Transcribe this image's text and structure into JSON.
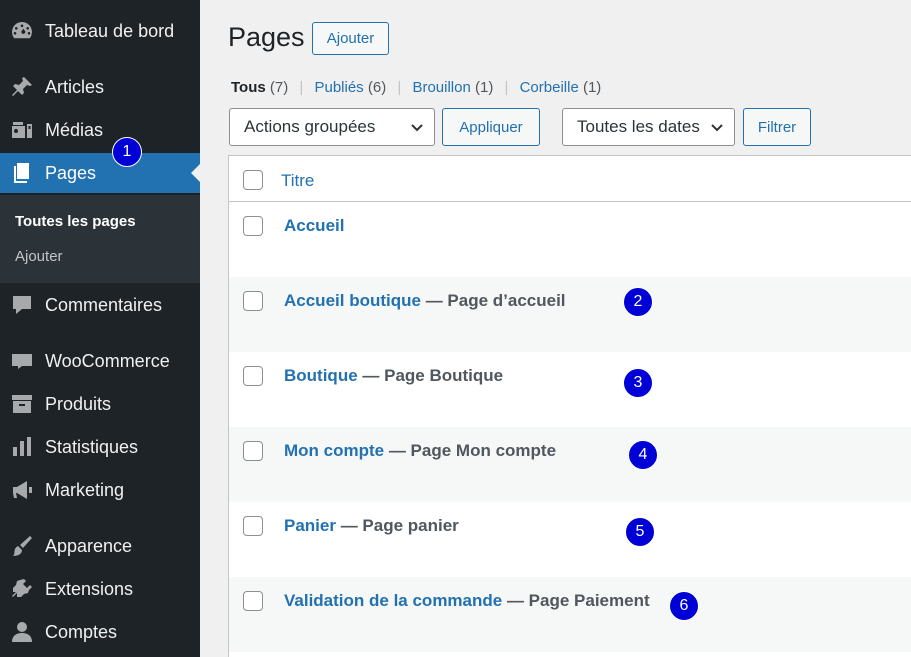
{
  "sidebar": {
    "items": [
      {
        "label": "Tableau de bord",
        "icon": "dashboard-icon"
      },
      {
        "label": "Articles",
        "icon": "pin-icon"
      },
      {
        "label": "Médias",
        "icon": "media-icon"
      },
      {
        "label": "Pages",
        "icon": "pages-icon",
        "active": true
      },
      {
        "label": "Commentaires",
        "icon": "comment-icon"
      },
      {
        "label": "WooCommerce",
        "icon": "woocommerce-icon"
      },
      {
        "label": "Produits",
        "icon": "archive-icon"
      },
      {
        "label": "Statistiques",
        "icon": "bar-chart-icon"
      },
      {
        "label": "Marketing",
        "icon": "megaphone-icon"
      },
      {
        "label": "Apparence",
        "icon": "brush-icon"
      },
      {
        "label": "Extensions",
        "icon": "plugin-icon"
      },
      {
        "label": "Comptes",
        "icon": "user-icon"
      }
    ],
    "submenu": {
      "all_pages": "Toutes les pages",
      "add": "Ajouter"
    }
  },
  "header": {
    "title": "Pages",
    "add_button": "Ajouter"
  },
  "filters": {
    "all": {
      "label": "Tous",
      "count": "(7)"
    },
    "published": {
      "label": "Publiés",
      "count": "(6)"
    },
    "draft": {
      "label": "Brouillon",
      "count": "(1)"
    },
    "trash": {
      "label": "Corbeille",
      "count": "(1)"
    },
    "separator": "|"
  },
  "toolbar": {
    "bulk_actions": "Actions groupées",
    "apply": "Appliquer",
    "dates": "Toutes les dates",
    "filter": "Filtrer"
  },
  "table": {
    "column_title": "Titre",
    "rows": [
      {
        "title": "Accueil",
        "state": ""
      },
      {
        "title": "Accueil boutique",
        "state": " — Page d’accueil"
      },
      {
        "title": "Boutique",
        "state": " — Page Boutique"
      },
      {
        "title": "Mon compte",
        "state": " — Page Mon compte"
      },
      {
        "title": "Panier",
        "state": " — Page panier"
      },
      {
        "title": "Validation de la commande",
        "state": " — Page Paiement"
      }
    ]
  },
  "annotations": [
    "1",
    "2",
    "3",
    "4",
    "5",
    "6"
  ],
  "colors": {
    "accent": "#2271b1",
    "sidebar": "#1d2327",
    "badge": "#0000d6"
  }
}
